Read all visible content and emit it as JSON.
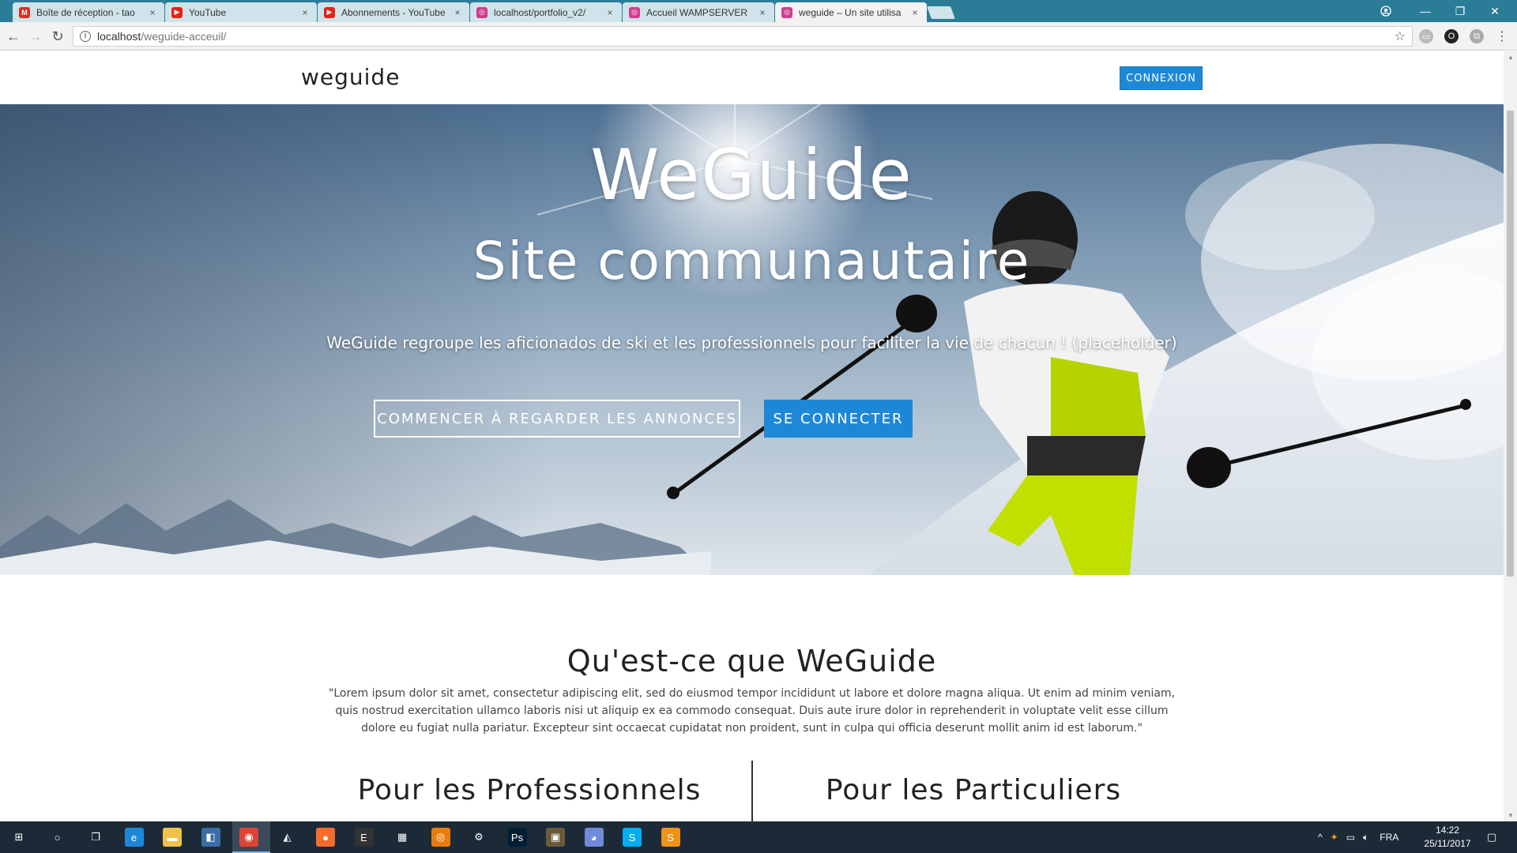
{
  "browser": {
    "tabs": [
      {
        "label": "Boîte de réception - tao",
        "icon": "gmail-icon",
        "color": "#d93025",
        "glyph": "M"
      },
      {
        "label": "YouTube",
        "icon": "youtube-icon",
        "color": "#e62117",
        "glyph": "▶"
      },
      {
        "label": "Abonnements - YouTube",
        "icon": "youtube-icon",
        "color": "#e62117",
        "glyph": "▶"
      },
      {
        "label": "localhost/portfolio_v2/",
        "icon": "site-icon",
        "color": "#d03b8f",
        "glyph": "◎"
      },
      {
        "label": "Accueil WAMPSERVER",
        "icon": "site-icon",
        "color": "#d03b8f",
        "glyph": "◎"
      },
      {
        "label": "weguide – Un site utilisa",
        "icon": "site-icon",
        "color": "#d03b8f",
        "glyph": "◎"
      }
    ],
    "active_tab": 5,
    "close_glyph": "×",
    "url_host": "localhost",
    "url_path": "/weguide-acceuil/"
  },
  "page": {
    "brand": "weguide",
    "login_button": "CONNEXION",
    "hero": {
      "title": "WeGuide",
      "subtitle": "Site communautaire",
      "text": "WeGuide regroupe les aficionados de ski et les professionnels pour faciliter la vie de chacun ! (placeholder)",
      "cta_outline": "COMMENCER À REGARDER LES ANNONCES",
      "cta_primary": "SE CONNECTER"
    },
    "about": {
      "title": "Qu'est-ce que WeGuide",
      "text": "\"Lorem ipsum dolor sit amet, consectetur adipiscing elit, sed do eiusmod tempor incididunt ut labore et dolore magna aliqua. Ut enim ad minim veniam, quis nostrud exercitation ullamco laboris nisi ut aliquip ex ea commodo consequat. Duis aute irure dolor in reprehenderit in voluptate velit esse cillum dolore eu fugiat nulla pariatur. Excepteur sint occaecat cupidatat non proident, sunt in culpa qui officia deserunt mollit anim id est laborum.\"",
      "col_left": "Pour les Professionnels",
      "col_right": "Pour les Particuliers"
    }
  },
  "taskbar": {
    "apps": [
      "windows-start-icon",
      "cortana-icon",
      "task-view-icon",
      "edge-icon",
      "file-explorer-icon",
      "store-icon",
      "chrome-icon",
      "app-icon",
      "origin-icon",
      "epic-icon",
      "calculator-icon",
      "blender-icon",
      "steam-icon",
      "photoshop-icon",
      "media-icon",
      "discord-icon",
      "skype-icon",
      "sublime-icon"
    ],
    "language": "FRA",
    "time": "14:22",
    "date": "25/11/2017"
  },
  "colors": {
    "accent": "#1e88d6",
    "tabstrip": "#2b7d97",
    "taskbar": "#1c2a38"
  }
}
